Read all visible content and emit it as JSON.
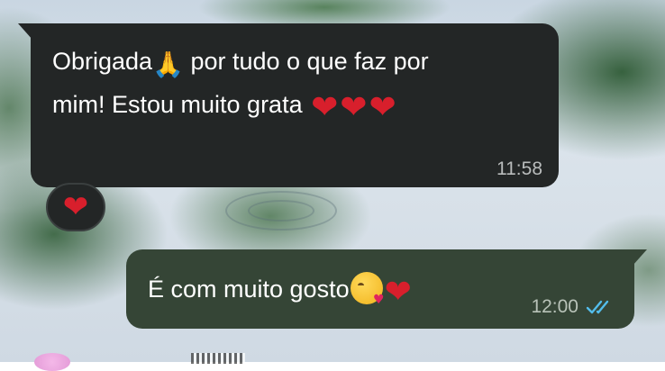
{
  "chat": {
    "incoming": {
      "text_part1": "Obrigada",
      "text_part2": " por tudo o que faz por",
      "text_line2": "mim! Estou muito grata ",
      "time": "11:58",
      "reaction": "heart-icon"
    },
    "outgoing": {
      "text": "É com muito gosto",
      "time": "12:00",
      "status": "read"
    }
  },
  "icons": {
    "pray": "folded-hands-icon",
    "hearts": [
      "heart-icon",
      "heart-icon",
      "heart-icon"
    ],
    "kiss": "kissing-face-icon",
    "read_ticks": "double-check-icon"
  },
  "colors": {
    "incoming_bubble": "#232626",
    "outgoing_bubble": "#354536",
    "heart": "#d81f2c",
    "read_ticks": "#53bdeb"
  }
}
